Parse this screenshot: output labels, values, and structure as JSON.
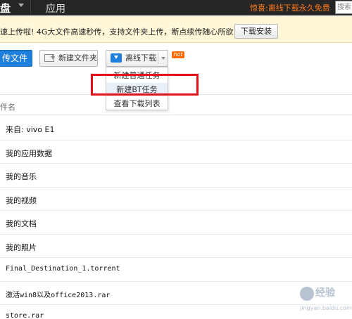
{
  "topbar": {
    "brand": "盘",
    "nav_app": "应用",
    "promo": "惊喜:离线下载永久免费",
    "search_placeholder": "搜索"
  },
  "notice": {
    "text": "速上传啦! 4G大文件高速秒传，支持文件夹上传，断点续传随心所欲!",
    "download_button": "下载安装"
  },
  "toolbar": {
    "upload_label": "传文件",
    "new_folder_label": "新建文件夹",
    "offline_download_label": "离线下载",
    "hot_badge": "hot"
  },
  "dropdown": {
    "items": [
      "新建普通任务",
      "新建BT任务",
      "查看下载列表"
    ],
    "highlighted_index": 1
  },
  "list": {
    "header_name": "件名",
    "files": [
      "来自: vivo E1",
      "我的应用数据",
      "我的音乐",
      "我的视频",
      "我的文档",
      "我的照片",
      "Final_Destination_1.torrent",
      "激活win8以及office2013.rar",
      "store.rar"
    ]
  },
  "watermark": {
    "text1": "经验",
    "text2": "jingyan.baidu.com"
  },
  "colors": {
    "topbar_bg": "#262626",
    "promo": "#ff7a1a",
    "notice_bg": "#fff7d7",
    "primary_blue": "#1f7fdc",
    "hot_badge": "#ff6a00",
    "highlight_box": "#e3101a"
  }
}
